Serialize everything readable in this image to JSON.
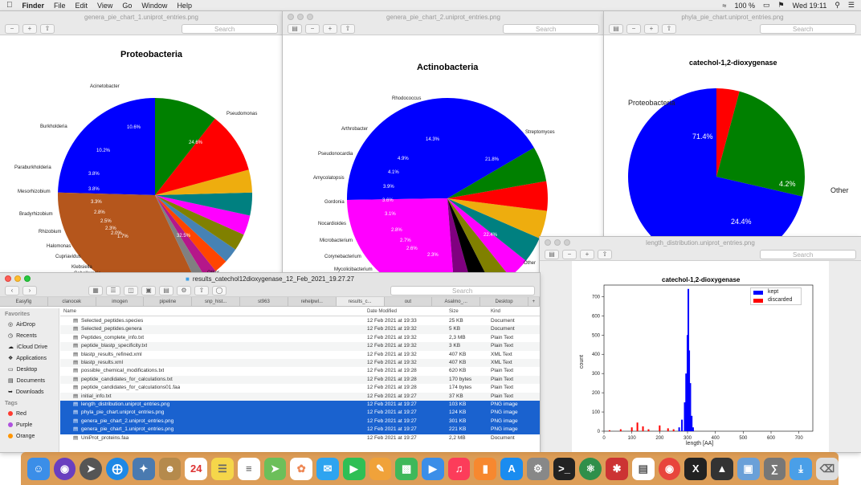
{
  "menubar": {
    "app": "Finder",
    "items": [
      "File",
      "Edit",
      "View",
      "Go",
      "Window",
      "Help"
    ],
    "battery": "100 %",
    "clock": "Wed 19:11"
  },
  "window1": {
    "title": "genera_pie_chart_1.uniprot_entries.png",
    "search_placeholder": "Search"
  },
  "window2": {
    "title": "genera_pie_chart_2.uniprot_entries.png",
    "search_placeholder": "Search"
  },
  "window3": {
    "title": "phyla_pie_chart.uniprot_entries.png",
    "search_placeholder": "Search"
  },
  "window4": {
    "title": "length_distribution.uniprot_entries.png",
    "search_placeholder": "Search"
  },
  "finder": {
    "path": "results_catechol12dioxygenase_12_Feb_2021_19.27.27",
    "search_placeholder": "Search",
    "tabs": [
      "Easyfig",
      "clanocek",
      "imogen",
      "pipeline",
      "snp_hist...",
      "st963",
      "rehelpwl...",
      "results_c...",
      "out",
      "Asalmo_...",
      "Desktop"
    ],
    "favorites_header": "Favorites",
    "favorites": [
      "AirDrop",
      "Recents",
      "iCloud Drive",
      "Applications",
      "Desktop",
      "Documents",
      "Downloads"
    ],
    "tags_header": "Tags",
    "tags": [
      {
        "name": "Red",
        "color": "#ff3b30"
      },
      {
        "name": "Purple",
        "color": "#af52de"
      },
      {
        "name": "Orange",
        "color": "#ff9500"
      }
    ],
    "columns": {
      "name": "Name",
      "date": "Date Modified",
      "size": "Size",
      "kind": "Kind"
    },
    "files": [
      {
        "name": "Selected_peptides.species",
        "date": "12 Feb 2021 at 19:33",
        "size": "25 KB",
        "kind": "Document"
      },
      {
        "name": "Selected_peptides.genera",
        "date": "12 Feb 2021 at 19:32",
        "size": "5 KB",
        "kind": "Document"
      },
      {
        "name": "Peptides_complete_info.txt",
        "date": "12 Feb 2021 at 19:32",
        "size": "2,3 MB",
        "kind": "Plain Text"
      },
      {
        "name": "peptide_blastp_specificity.txt",
        "date": "12 Feb 2021 at 19:32",
        "size": "3 KB",
        "kind": "Plain Text"
      },
      {
        "name": "blastp_results_refined.xml",
        "date": "12 Feb 2021 at 19:32",
        "size": "407 KB",
        "kind": "XML Text"
      },
      {
        "name": "blastp_results.xml",
        "date": "12 Feb 2021 at 19:32",
        "size": "407 KB",
        "kind": "XML Text"
      },
      {
        "name": "possible_chemical_modifications.txt",
        "date": "12 Feb 2021 at 19:28",
        "size": "620 KB",
        "kind": "Plain Text"
      },
      {
        "name": "peptide_candidates_for_calculations.txt",
        "date": "12 Feb 2021 at 19:28",
        "size": "170 bytes",
        "kind": "Plain Text"
      },
      {
        "name": "peptide_candidates_for_calculations01.faa",
        "date": "12 Feb 2021 at 19:28",
        "size": "174 bytes",
        "kind": "Plain Text"
      },
      {
        "name": "initial_info.txt",
        "date": "12 Feb 2021 at 19:27",
        "size": "37 KB",
        "kind": "Plain Text"
      },
      {
        "name": "length_distribution.uniprot_entries.png",
        "date": "12 Feb 2021 at 19:27",
        "size": "103 KB",
        "kind": "PNG image"
      },
      {
        "name": "phyla_pie_chart.uniprot_entries.png",
        "date": "12 Feb 2021 at 19:27",
        "size": "124 KB",
        "kind": "PNG image"
      },
      {
        "name": "genera_pie_chart_2.uniprot_entries.png",
        "date": "12 Feb 2021 at 19:27",
        "size": "301 KB",
        "kind": "PNG image"
      },
      {
        "name": "genera_pie_chart_1.uniprot_entries.png",
        "date": "12 Feb 2021 at 19:27",
        "size": "221 KB",
        "kind": "PNG image"
      },
      {
        "name": "UniProt_proteins.faa",
        "date": "12 Feb 2021 at 19:27",
        "size": "2,2 MB",
        "kind": "Document"
      }
    ]
  },
  "chart_data": [
    {
      "type": "pie",
      "title": "Proteobacteria",
      "categories": [
        "Pseudomonas",
        "Other",
        "",
        "",
        "",
        "",
        "Cupriavidus",
        "Halomonas",
        "Rhizobium",
        "Bradyrhizobium",
        "Mesorhizobium",
        "Paraburkholderia",
        "Burkholderia",
        "Acinetobacter"
      ],
      "values": [
        24.6,
        32.5,
        1.7,
        2.0,
        2.3,
        2.5,
        2.8,
        3.3,
        3.8,
        3.8,
        10.2,
        10.6
      ],
      "value_labels": [
        "24.6%",
        "32.5%",
        "1.7%",
        "2.0%",
        "2.3%",
        "2.5%",
        "2.8%",
        "3.3%",
        "3.8%",
        "3.8%",
        "10.2%",
        "10.6%"
      ],
      "colors": [
        "#0000ff",
        "#b5561c",
        "#808080",
        "#b5178a",
        "#ff4500",
        "#4682b4",
        "#808000",
        "#ff00ff",
        "#008080",
        "#eead0e",
        "#ff0000",
        "#008000"
      ],
      "visible_labels": [
        "Pseudomonas",
        "Other",
        "Klebsiella",
        "Caballeronia",
        "Cupriavidus",
        "Halomonas",
        "Rhizobium",
        "Bradyrhizobium",
        "Mesorhizobium",
        "Paraburkholderia",
        "Burkholderia",
        "Acinetobacter"
      ]
    },
    {
      "type": "pie",
      "title": "Actinobacteria",
      "labels": [
        "Streptomyces",
        "Other",
        "Mycolicibacterium",
        "Corynebacterium",
        "Microbacterium",
        "Nocardioides",
        "Gordonia",
        "Amycolatopsis",
        "Pseudonocardia",
        "Arthrobacter",
        "Rhodococcus"
      ],
      "values": [
        21.8,
        22.4,
        2.7,
        2.7,
        2.8,
        3.1,
        3.6,
        3.9,
        4.1,
        4.9,
        14.3
      ],
      "value_labels": [
        "21.8%",
        "22.4%",
        "2.3%",
        "2.6%",
        "2.7%",
        "2.8%",
        "3.1%",
        "3.6%",
        "3.9%",
        "4.1%",
        "4.9%",
        "14.3%"
      ],
      "colors": [
        "#0000ff",
        "#ff00ff",
        "#800080",
        "#000000",
        "#808000",
        "#ff00ff",
        "#008080",
        "#eead0e",
        "#ff0000",
        "#008000"
      ]
    },
    {
      "type": "pie",
      "title": "catechol-1,2-dioxygenase",
      "labels": [
        "Proteobacteria",
        "Other",
        ""
      ],
      "values": [
        71.4,
        4.2,
        24.4
      ],
      "value_labels": [
        "71.4%",
        "4.2%",
        "24.4%"
      ],
      "colors": [
        "#0000ff",
        "#ff0000",
        "#008000"
      ]
    },
    {
      "type": "histogram",
      "title": "catechol-1,2-dioxygenase",
      "xlabel": "length [AA]",
      "ylabel": "count",
      "xlim": [
        0,
        750
      ],
      "ylim": [
        0,
        760
      ],
      "xticks": [
        0,
        100,
        200,
        300,
        400,
        500,
        600,
        700
      ],
      "yticks": [
        0,
        100,
        200,
        300,
        400,
        500,
        600,
        700
      ],
      "series": [
        {
          "name": "kept",
          "color": "#0000ff",
          "x": [
            270,
            280,
            290,
            295,
            300,
            303,
            306,
            310,
            315,
            320
          ],
          "y": [
            20,
            60,
            150,
            300,
            500,
            740,
            420,
            250,
            80,
            20
          ]
        },
        {
          "name": "discarded",
          "color": "#ff0000",
          "x": [
            20,
            60,
            100,
            120,
            140,
            160,
            200,
            230,
            250
          ],
          "y": [
            5,
            10,
            20,
            45,
            25,
            10,
            30,
            15,
            10
          ]
        }
      ],
      "legend": "top-right"
    }
  ]
}
